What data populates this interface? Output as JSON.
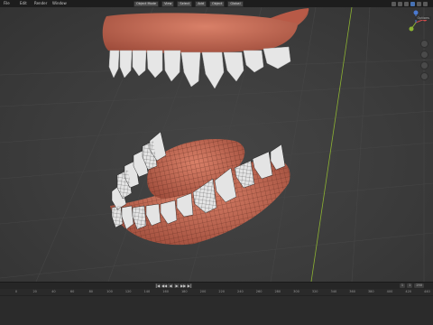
{
  "menubar": {
    "items": [
      "File",
      "Edit",
      "Render",
      "Window"
    ],
    "mode": "Object Mode",
    "view_menu": [
      "View",
      "Select",
      "Add",
      "Object"
    ],
    "transform": "Global"
  },
  "viewport": {
    "options_label": "Options",
    "gizmo_axes": [
      "X",
      "Y",
      "Z"
    ]
  },
  "timeline": {
    "playback_icons": [
      "|◀",
      "◀◀",
      "◀",
      "▶",
      "▶▶",
      "▶|"
    ],
    "current_frame": "1",
    "start": "1",
    "end": "250",
    "ruler_ticks": [
      "0",
      "20",
      "40",
      "60",
      "80",
      "100",
      "120",
      "140",
      "160",
      "180",
      "200",
      "220",
      "240",
      "260",
      "280",
      "300",
      "320",
      "340",
      "360",
      "380",
      "400",
      "420",
      "440"
    ]
  },
  "colors": {
    "gum": "#c46a55",
    "tooth": "#e8e8e8",
    "axis_y": "#8db332",
    "axis_x": "#d24b4b"
  }
}
